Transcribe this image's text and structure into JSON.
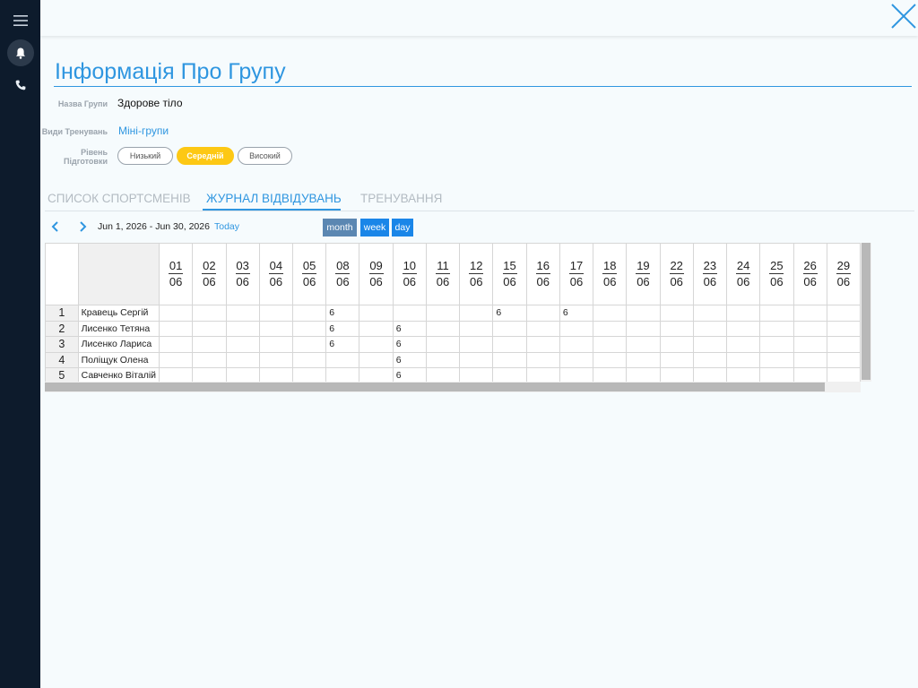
{
  "header": {
    "title": "Інформація Про Групу"
  },
  "fields": {
    "group_name_label": "Назва Групи",
    "group_name_value": "Здорове тіло",
    "training_type_label": "Види Тренувань",
    "training_type_value": "Міні-групи",
    "level_label_line1": "Рівень",
    "level_label_line2": "Підготовки",
    "levels": [
      "Низький",
      "Середній",
      "Високий"
    ],
    "selected_level": "Середній"
  },
  "tabs": [
    "СПИСОК СПОРТСМЕНІВ",
    "ЖУРНАЛ ВІДВІДУВАНЬ",
    "ТРЕНУВАННЯ"
  ],
  "active_tab": "ЖУРНАЛ ВІДВІДУВАНЬ",
  "calendar": {
    "range": "Jun 1, 2026 - Jun 30, 2026",
    "today": "Today",
    "views": [
      "month",
      "week",
      "day"
    ],
    "active_view": "month"
  },
  "journal": {
    "dates": [
      {
        "day": "01",
        "month": "06"
      },
      {
        "day": "02",
        "month": "06"
      },
      {
        "day": "03",
        "month": "06"
      },
      {
        "day": "04",
        "month": "06"
      },
      {
        "day": "05",
        "month": "06"
      },
      {
        "day": "08",
        "month": "06"
      },
      {
        "day": "09",
        "month": "06"
      },
      {
        "day": "10",
        "month": "06"
      },
      {
        "day": "11",
        "month": "06"
      },
      {
        "day": "12",
        "month": "06"
      },
      {
        "day": "15",
        "month": "06"
      },
      {
        "day": "16",
        "month": "06"
      },
      {
        "day": "17",
        "month": "06"
      },
      {
        "day": "18",
        "month": "06"
      },
      {
        "day": "19",
        "month": "06"
      },
      {
        "day": "22",
        "month": "06"
      },
      {
        "day": "23",
        "month": "06"
      },
      {
        "day": "24",
        "month": "06"
      },
      {
        "day": "25",
        "month": "06"
      },
      {
        "day": "26",
        "month": "06"
      },
      {
        "day": "29",
        "month": "06"
      }
    ],
    "rows": [
      {
        "num": "1",
        "name": "Кравець Сергій",
        "cells": [
          "",
          "",
          "",
          "",
          "",
          "6",
          "",
          "",
          "",
          "",
          "6",
          "",
          "6",
          "",
          "",
          "",
          "",
          "",
          "",
          "",
          ""
        ]
      },
      {
        "num": "2",
        "name": "Лисенко  Тетяна",
        "cells": [
          "",
          "",
          "",
          "",
          "",
          "6",
          "",
          "6",
          "",
          "",
          "",
          "",
          "",
          "",
          "",
          "",
          "",
          "",
          "",
          "",
          ""
        ]
      },
      {
        "num": "3",
        "name": "Лисенко Лариса",
        "cells": [
          "",
          "",
          "",
          "",
          "",
          "6",
          "",
          "6",
          "",
          "",
          "",
          "",
          "",
          "",
          "",
          "",
          "",
          "",
          "",
          "",
          ""
        ]
      },
      {
        "num": "4",
        "name": "Поліщук Олена",
        "cells": [
          "",
          "",
          "",
          "",
          "",
          "",
          "",
          "6",
          "",
          "",
          "",
          "",
          "",
          "",
          "",
          "",
          "",
          "",
          "",
          "",
          ""
        ]
      },
      {
        "num": "5",
        "name": "Савченко Віталій",
        "cells": [
          "",
          "",
          "",
          "",
          "",
          "",
          "",
          "6",
          "",
          "",
          "",
          "",
          "",
          "",
          "",
          "",
          "",
          "",
          "",
          "",
          ""
        ]
      }
    ]
  },
  "colors": {
    "accent": "#2f96e0",
    "sidebar": "#0d1b2c",
    "level_active": "#fdc814",
    "view_button": "#1a86e8",
    "view_button_active": "#5b87b2"
  },
  "icons": {
    "menu": "menu-icon",
    "bell": "bell-icon",
    "phone": "phone-icon",
    "close": "close-icon",
    "prev": "chevron-left-icon",
    "next": "chevron-right-icon"
  }
}
